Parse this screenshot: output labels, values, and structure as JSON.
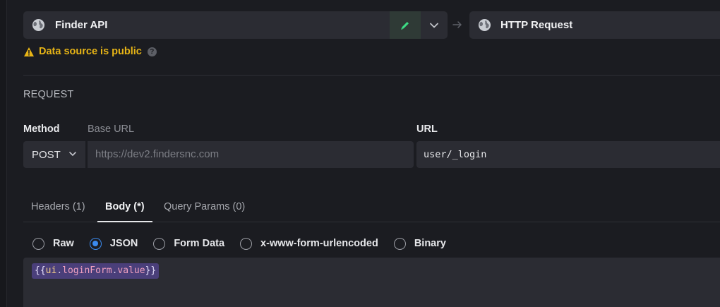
{
  "datasource": {
    "name": "Finder API",
    "target": "HTTP Request",
    "warning": "Data source is public",
    "help": "?"
  },
  "icons": {
    "source": "globe-icon",
    "edit": "pencil-icon",
    "dropdown": "chevron-down-icon",
    "separator": "arrow-right-icon",
    "warning": "warning-triangle-icon"
  },
  "request": {
    "section_title": "REQUEST",
    "method_label": "Method",
    "base_url_label": "Base URL",
    "url_label": "URL",
    "method_value": "POST",
    "base_url_value": "https://dev2.findersnc.com",
    "url_value": "user/_login"
  },
  "tabs": [
    {
      "label": "Headers (1)",
      "active": false
    },
    {
      "label": "Body (*)",
      "active": true
    },
    {
      "label": "Query Params (0)",
      "active": false
    }
  ],
  "body_types": [
    {
      "label": "Raw",
      "checked": false
    },
    {
      "label": "JSON",
      "checked": true
    },
    {
      "label": "Form Data",
      "checked": false
    },
    {
      "label": "x-www-form-urlencoded",
      "checked": false
    },
    {
      "label": "Binary",
      "checked": false
    }
  ],
  "editor": {
    "open": "{{",
    "ident": "ui",
    "dot1": ".",
    "prop1": "loginForm",
    "dot2": ".",
    "prop2": "value",
    "close": "}}"
  },
  "colors": {
    "background": "#1b1c21",
    "panel": "#2b2c33",
    "warning": "#e7b416",
    "accent": "#3b8bf0",
    "edit_icon": "#3ddc84",
    "chip": "#4a3f7a"
  }
}
